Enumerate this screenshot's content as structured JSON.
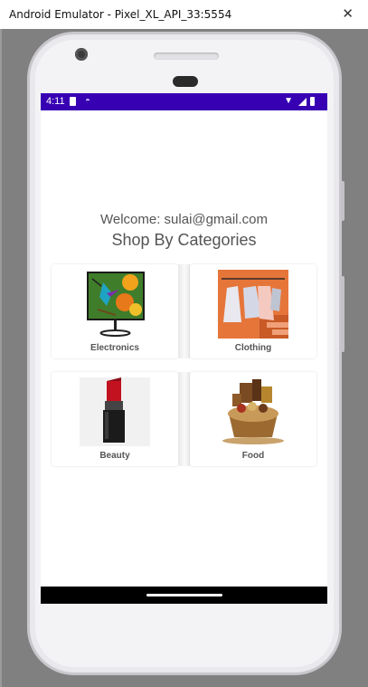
{
  "window": {
    "title": "Android Emulator - Pixel_XL_API_33:5554",
    "close_glyph": "✕"
  },
  "status_bar": {
    "time": "4:11",
    "accent": "#3700b3"
  },
  "header": {
    "welcome": "Welcome: sulai@gmail.com",
    "title": "Shop By Categories"
  },
  "categories": [
    {
      "label": "Electronics",
      "icon": "tv-hummingbird-image"
    },
    {
      "label": "Clothing",
      "icon": "clothes-rack-image"
    },
    {
      "label": "Beauty",
      "icon": "lipstick-image"
    },
    {
      "label": "Food",
      "icon": "gift-basket-image"
    }
  ]
}
